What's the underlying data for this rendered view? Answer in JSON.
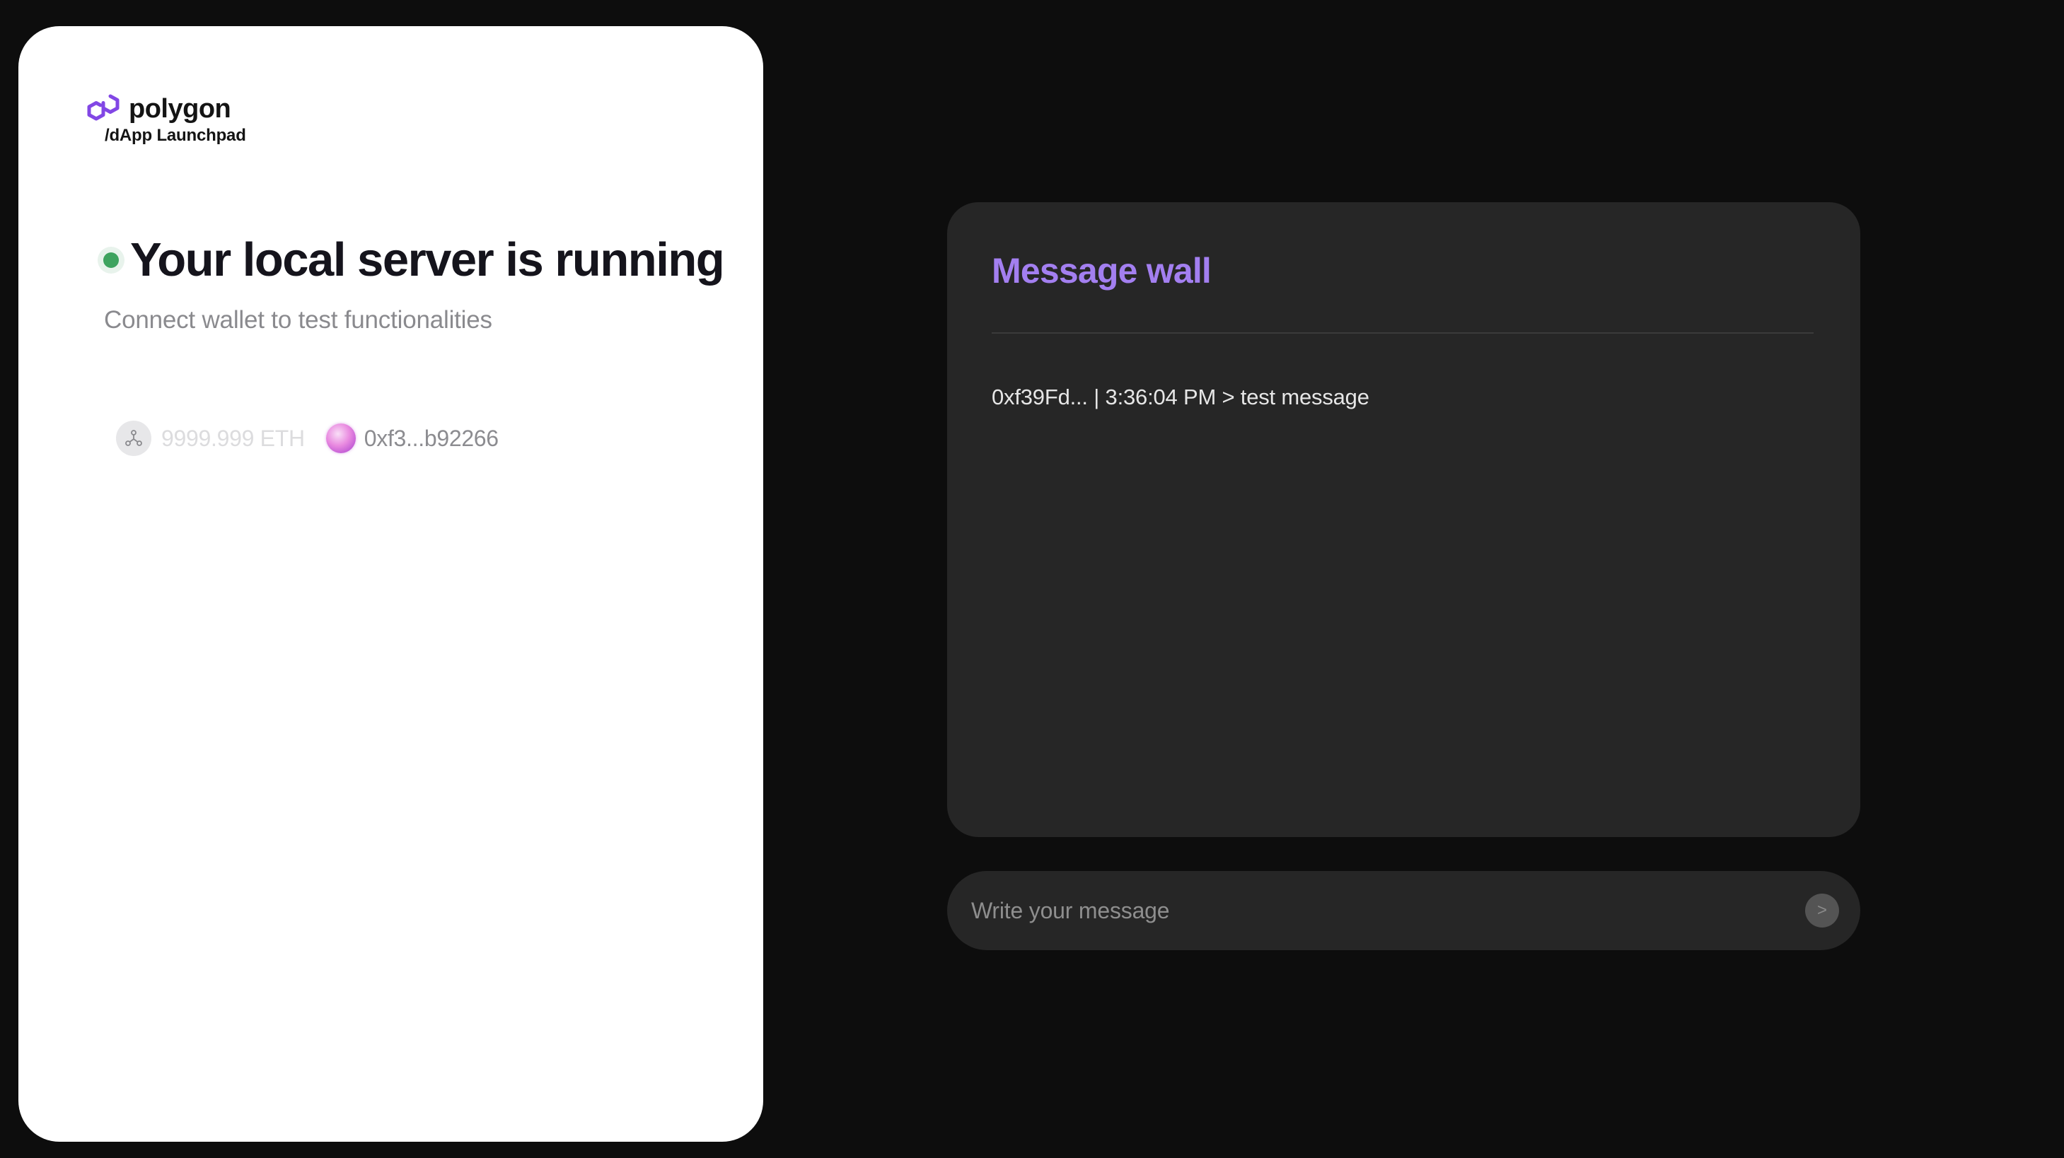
{
  "brand": {
    "name": "polygon",
    "subtitle": "/dApp Launchpad",
    "logo_icon": "polygon-logo-icon",
    "accent_color": "#8247e5"
  },
  "status": {
    "title": "Your local server is running",
    "subtitle": "Connect wallet to test functionalities",
    "indicator_color": "#3ea35f"
  },
  "wallet": {
    "network_icon": "network-icon",
    "balance": "9999.999 ETH",
    "avatar_icon": "account-avatar-icon",
    "address": "0xf3...b92266"
  },
  "message_wall": {
    "title": "Message wall",
    "title_color": "#a37ff0",
    "messages": [
      "0xf39Fd... | 3:36:04 PM > test message"
    ]
  },
  "composer": {
    "placeholder": "Write your message",
    "value": "",
    "send_label": ">"
  }
}
